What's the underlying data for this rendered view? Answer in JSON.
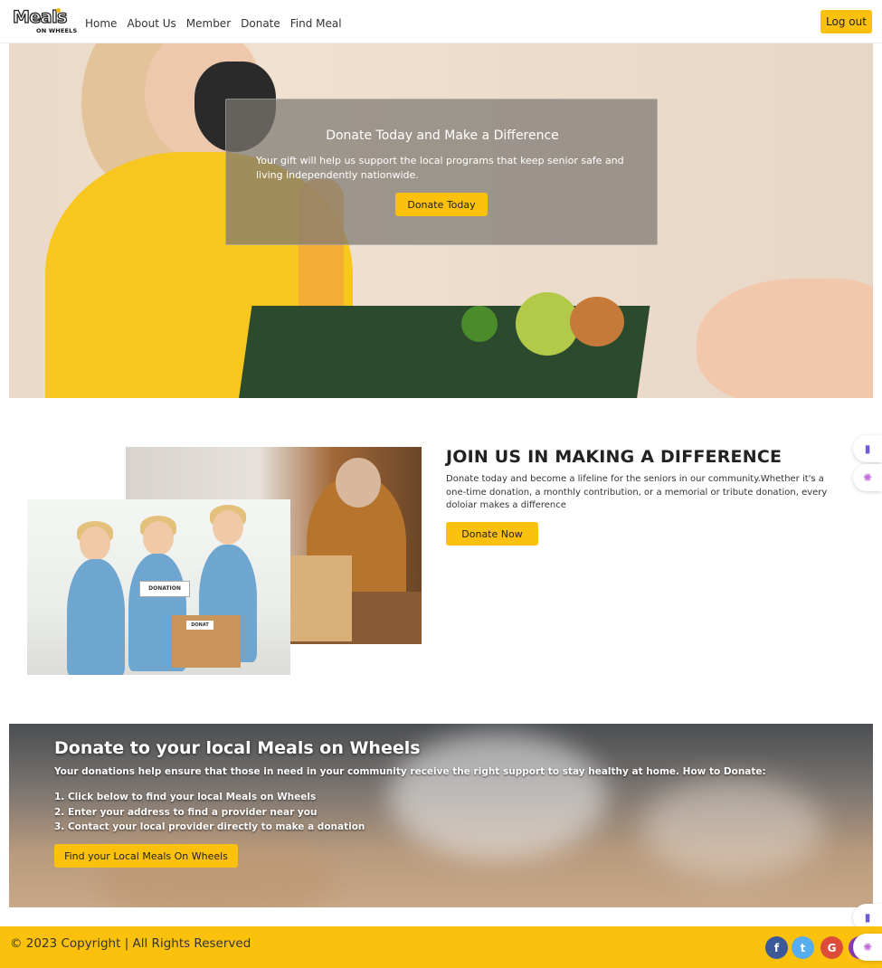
{
  "nav": {
    "logo_main": "Meals",
    "logo_sub": "ON WHEELS",
    "links": [
      "Home",
      "About Us",
      "Member",
      "Donate",
      "Find Meal"
    ],
    "logout_label": "Log out"
  },
  "hero": {
    "title": "Donate Today and Make a Difference",
    "text": "Your gift will help us support the local programs that keep senior safe and living independently nationwide.",
    "button_label": "Donate Today"
  },
  "join": {
    "title": "JOIN US IN MAKING A DIFFERENCE",
    "text": "Donate today and become a lifeline for the seniors in our community.Whether it's a one-time donation, a monthly contribution, or a memorial or tribute donation, every doloiar makes a difference",
    "button_label": "Donate Now",
    "photo_sign_1": "DONATION",
    "photo_sign_2": "DONAT"
  },
  "local": {
    "title": "Donate to your local Meals on Wheels",
    "text": "Your donations help ensure that those in need in your community receive the right support to stay healthy at home. How to Donate:",
    "steps": [
      "1. Click below to find your local Meals on Wheels",
      "2. Enter your address to find a provider near you",
      "3. Contact your local provider directly to make a donation"
    ],
    "button_label": "Find your Local Meals On Wheels"
  },
  "footer": {
    "copyright": "© 2023 Copyright | All Rights Reserved",
    "social": [
      {
        "name": "facebook-icon",
        "glyph": "f"
      },
      {
        "name": "twitter-icon",
        "glyph": "t"
      },
      {
        "name": "google-icon",
        "glyph": "G"
      },
      {
        "name": "instagram-icon",
        "glyph": "◎"
      }
    ]
  },
  "colors": {
    "accent": "#fcc10c",
    "footer_bg": "#fcc10c"
  },
  "floating_widgets": [
    "book-icon",
    "brain-icon"
  ]
}
